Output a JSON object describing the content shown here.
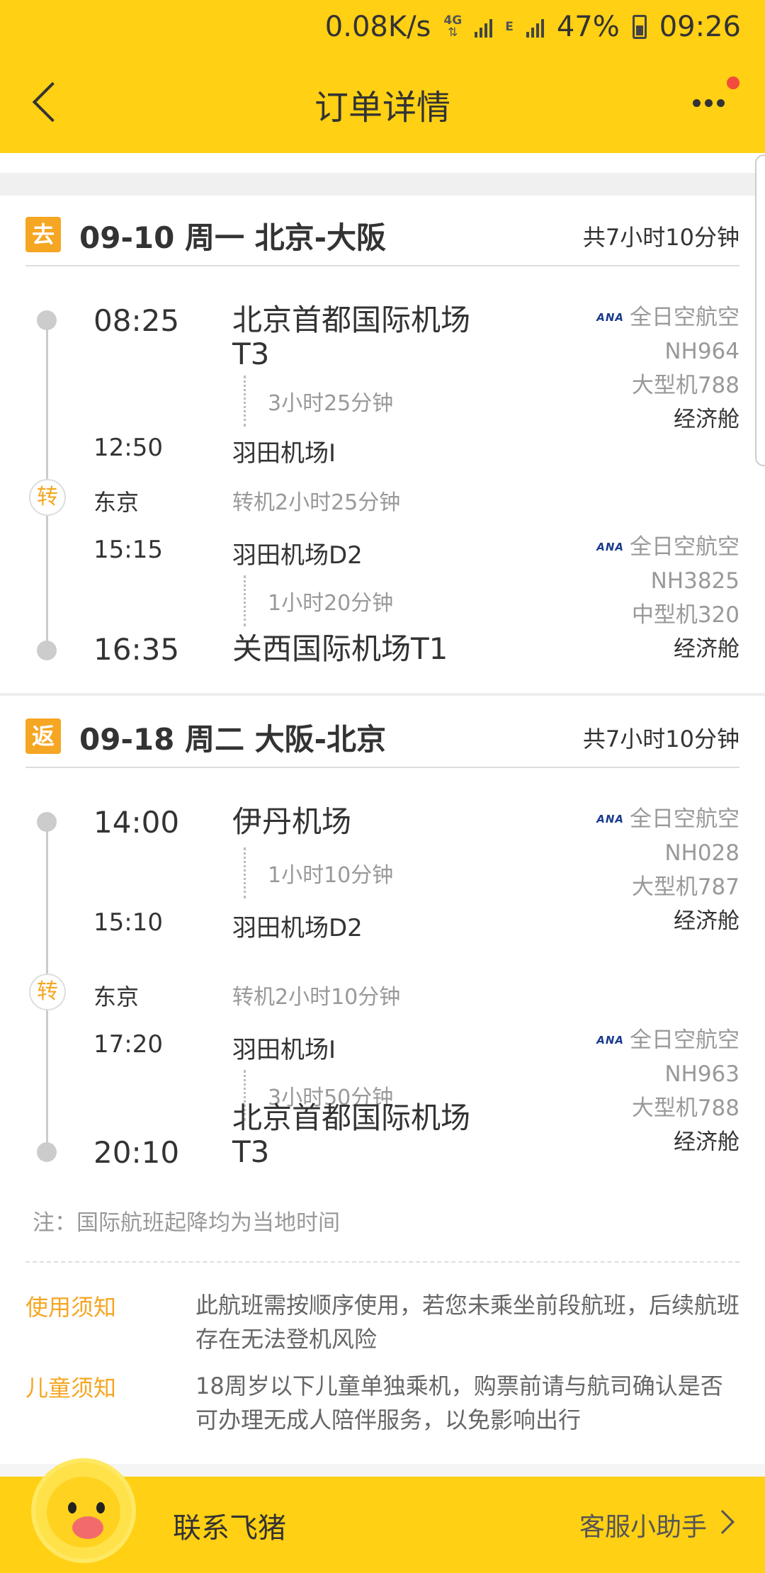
{
  "status_bar": {
    "speed": "0.08K/s",
    "net1": "4G",
    "net2": "E",
    "battery": "47%",
    "time": "09:26"
  },
  "header": {
    "title": "订单详情"
  },
  "outbound": {
    "tag": "去",
    "date_route": "09-10 周一 北京-大阪",
    "total": "共7小时10分钟",
    "seg1": {
      "dep_time": "08:25",
      "dep_airport_l1": "北京首都国际机场",
      "dep_airport_l2": "T3",
      "duration": "3小时25分钟",
      "arr_time": "12:50",
      "arr_airport": "羽田机场I",
      "airline": "全日空航空",
      "flight": "NH964",
      "plane": "大型机788",
      "cabin": "经济舱"
    },
    "transfer": {
      "tag": "转",
      "city": "东京",
      "text": "转机2小时25分钟"
    },
    "seg2": {
      "dep_time": "15:15",
      "dep_airport": "羽田机场D2",
      "duration": "1小时20分钟",
      "arr_time": "16:35",
      "arr_airport": "关西国际机场T1",
      "airline": "全日空航空",
      "flight": "NH3825",
      "plane": "中型机320",
      "cabin": "经济舱"
    }
  },
  "return": {
    "tag": "返",
    "date_route": "09-18 周二 大阪-北京",
    "total": "共7小时10分钟",
    "seg1": {
      "dep_time": "14:00",
      "dep_airport": "伊丹机场",
      "duration": "1小时10分钟",
      "arr_time": "15:10",
      "arr_airport": "羽田机场D2",
      "airline": "全日空航空",
      "flight": "NH028",
      "plane": "大型机787",
      "cabin": "经济舱"
    },
    "transfer": {
      "tag": "转",
      "city": "东京",
      "text": "转机2小时10分钟"
    },
    "seg2": {
      "dep_time": "17:20",
      "dep_airport": "羽田机场I",
      "duration": "3小时50分钟",
      "arr_time": "20:10",
      "arr_airport_l1": "北京首都国际机场",
      "arr_airport_l2": "T3",
      "airline": "全日空航空",
      "flight": "NH963",
      "plane": "大型机788",
      "cabin": "经济舱"
    }
  },
  "airline_logo": "ANA",
  "note": "注：国际航班起降均为当地时间",
  "notices": [
    {
      "label": "使用须知",
      "text": "此航班需按顺序使用，若您未乘坐前段航班，后续航班存在无法登机风险"
    },
    {
      "label": "儿童须知",
      "text": "18周岁以下儿童单独乘机，购票前请与航司确认是否可办理无成人陪伴服务，以免影响出行"
    }
  ],
  "bottom": {
    "contact": "联系飞猪",
    "helper": "客服小助手"
  }
}
